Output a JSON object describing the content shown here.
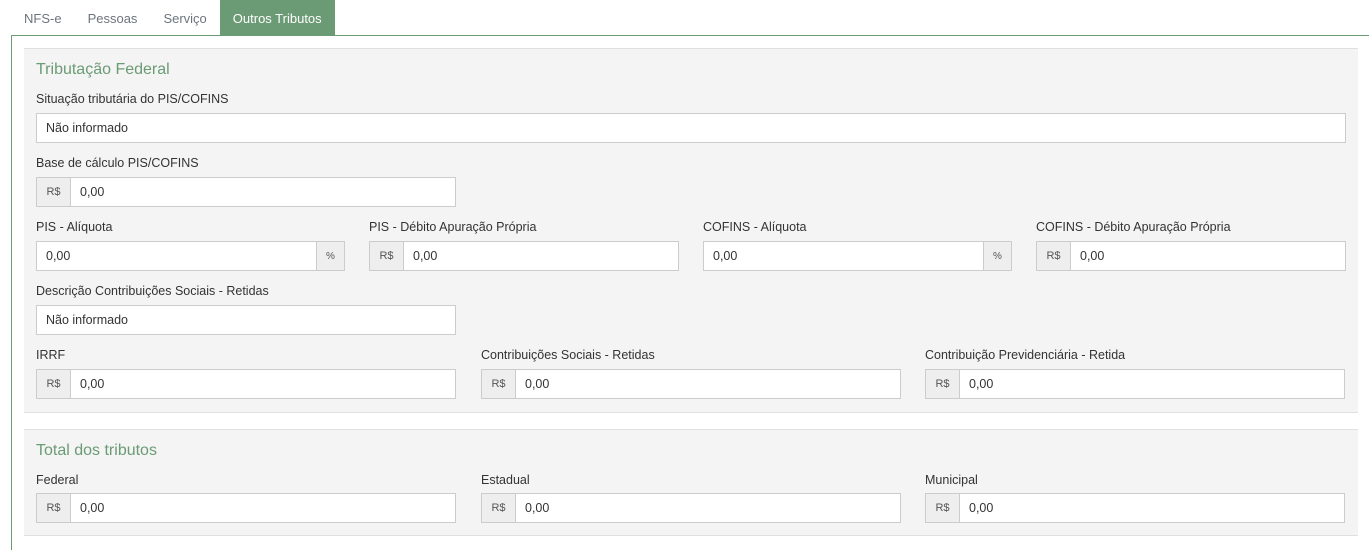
{
  "tabs": [
    {
      "label": "NFS-e"
    },
    {
      "label": "Pessoas"
    },
    {
      "label": "Serviço"
    },
    {
      "label": "Outros Tributos"
    }
  ],
  "federal": {
    "title": "Tributação Federal",
    "situacao": {
      "label": "Situação tributária do PIS/COFINS",
      "value": "Não informado"
    },
    "base_calculo": {
      "label": "Base de cálculo PIS/COFINS",
      "prefix": "R$",
      "value": "0,00"
    },
    "pis_aliquota": {
      "label": "PIS - Alíquota",
      "suffix": "%",
      "value": "0,00"
    },
    "pis_debito": {
      "label": "PIS - Débito Apuração Própria",
      "prefix": "R$",
      "value": "0,00"
    },
    "cofins_aliquota": {
      "label": "COFINS - Alíquota",
      "suffix": "%",
      "value": "0,00"
    },
    "cofins_debito": {
      "label": "COFINS - Débito Apuração Própria",
      "prefix": "R$",
      "value": "0,00"
    },
    "descricao_contrib": {
      "label": "Descrição Contribuições Sociais - Retidas",
      "value": "Não informado"
    },
    "irrf": {
      "label": "IRRF",
      "prefix": "R$",
      "value": "0,00"
    },
    "contrib_sociais": {
      "label": "Contribuições Sociais - Retidas",
      "prefix": "R$",
      "value": "0,00"
    },
    "contrib_prev": {
      "label": "Contribuição Previdenciária - Retida",
      "prefix": "R$",
      "value": "0,00"
    }
  },
  "totais": {
    "title": "Total dos tributos",
    "federal": {
      "label": "Federal",
      "prefix": "R$",
      "value": "0,00"
    },
    "estadual": {
      "label": "Estadual",
      "prefix": "R$",
      "value": "0,00"
    },
    "municipal": {
      "label": "Municipal",
      "prefix": "R$",
      "value": "0,00"
    }
  },
  "colors": {
    "accent": "#6b9b74",
    "section_bg": "#f4f4f4",
    "addon_bg": "#eeeeee"
  }
}
